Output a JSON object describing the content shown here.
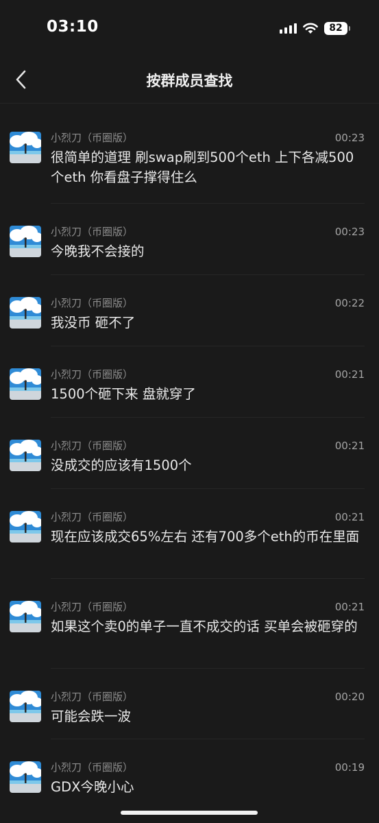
{
  "status_bar": {
    "time": "03:10",
    "battery": "82"
  },
  "nav": {
    "title": "按群成员查找"
  },
  "messages": [
    {
      "sender": "小烈刀（币圈版）",
      "time": "00:23",
      "text": "很简单的道理 刷swap刷到500个eth 上下各减500个eth 你看盘子撑得住么"
    },
    {
      "sender": "小烈刀（币圈版）",
      "time": "00:23",
      "text": "今晚我不会接的"
    },
    {
      "sender": "小烈刀（币圈版）",
      "time": "00:22",
      "text": "我没币 砸不了"
    },
    {
      "sender": "小烈刀（币圈版）",
      "time": "00:21",
      "text": "1500个砸下来 盘就穿了"
    },
    {
      "sender": "小烈刀（币圈版）",
      "time": "00:21",
      "text": "没成交的应该有1500个"
    },
    {
      "sender": "小烈刀（币圈版）",
      "time": "00:21",
      "text": "现在应该成交65%左右 还有700多个eth的币在里面"
    },
    {
      "sender": "小烈刀（币圈版）",
      "time": "00:21",
      "text": "如果这个卖0的单子一直不成交的话 买单会被砸穿的"
    },
    {
      "sender": "小烈刀（币圈版）",
      "time": "00:20",
      "text": "可能会跌一波"
    },
    {
      "sender": "小烈刀（币圈版）",
      "time": "00:19",
      "text": "GDX今晚小心"
    }
  ]
}
